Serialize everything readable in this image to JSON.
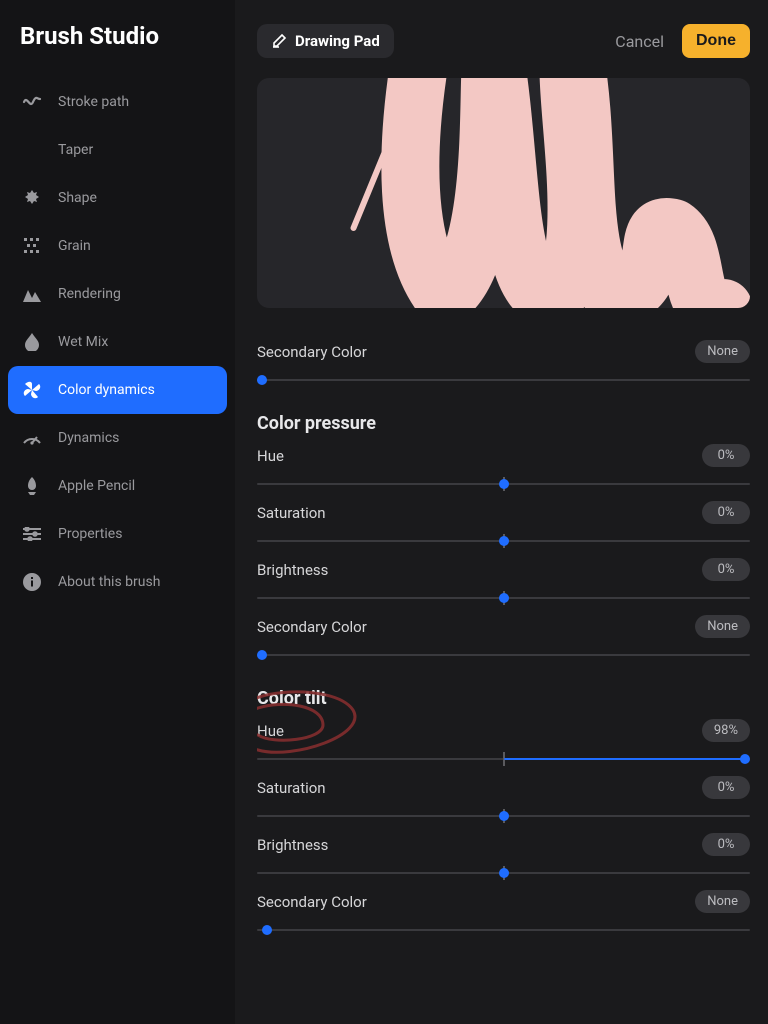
{
  "app_title": "Brush Studio",
  "topbar": {
    "crumb": "Drawing Pad",
    "cancel": "Cancel",
    "done": "Done"
  },
  "sidebar": {
    "items": [
      {
        "label": "Stroke path"
      },
      {
        "label": "Taper"
      },
      {
        "label": "Shape"
      },
      {
        "label": "Grain"
      },
      {
        "label": "Rendering"
      },
      {
        "label": "Wet Mix"
      },
      {
        "label": "Color dynamics"
      },
      {
        "label": "Dynamics"
      },
      {
        "label": "Apple Pencil"
      },
      {
        "label": "Properties"
      },
      {
        "label": "About this brush"
      }
    ],
    "active_index": 6
  },
  "sliders": {
    "top_secondary": {
      "label": "Secondary Color",
      "value_text": "None",
      "thumb_pct": 0,
      "tick": false
    },
    "color_pressure": {
      "heading": "Color pressure",
      "hue": {
        "label": "Hue",
        "value_text": "0%",
        "thumb_pct": 50,
        "tick": true
      },
      "sat": {
        "label": "Saturation",
        "value_text": "0%",
        "thumb_pct": 50,
        "tick": true
      },
      "bri": {
        "label": "Brightness",
        "value_text": "0%",
        "thumb_pct": 50,
        "tick": true
      },
      "secondary": {
        "label": "Secondary Color",
        "value_text": "None",
        "thumb_pct": 0,
        "tick": false
      }
    },
    "color_tilt": {
      "heading": "Color tilt",
      "hue": {
        "label": "Hue",
        "value_text": "98%",
        "thumb_pct": 98,
        "fill_from": 50,
        "tick": true
      },
      "sat": {
        "label": "Saturation",
        "value_text": "0%",
        "thumb_pct": 50,
        "tick": true
      },
      "bri": {
        "label": "Brightness",
        "value_text": "0%",
        "thumb_pct": 50,
        "tick": true
      },
      "secondary": {
        "label": "Secondary Color",
        "value_text": "None",
        "thumb_pct": 0,
        "tick": false
      }
    }
  },
  "colors": {
    "accent": "#1f6dff",
    "done": "#f6b12c",
    "stroke": "#f3c8c4"
  }
}
